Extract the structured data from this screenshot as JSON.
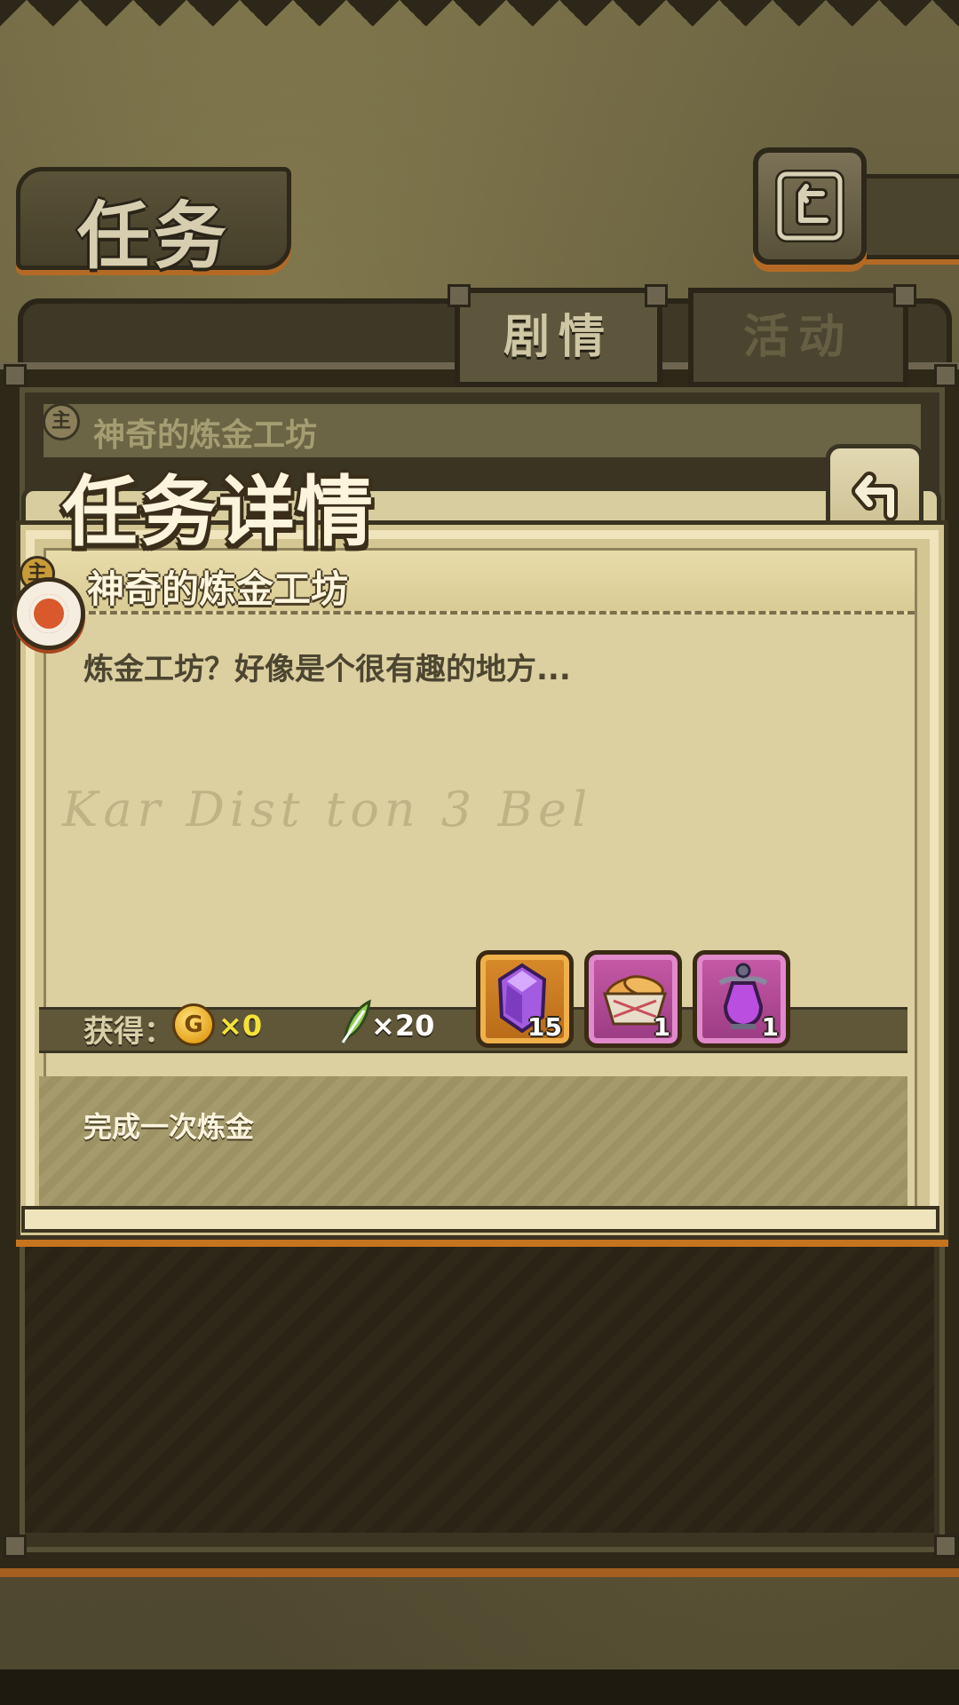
{
  "header": {
    "title": "任务",
    "back_icon": "return-arrow-icon"
  },
  "tabs": [
    {
      "label": "剧情",
      "active": true
    },
    {
      "label": "活动",
      "active": false
    }
  ],
  "quest_list": {
    "items": [
      {
        "badge": "主",
        "name": "神奇的炼金工坊"
      }
    ]
  },
  "detail": {
    "title": "任务详情",
    "badge": "主",
    "quest_name": "神奇的炼金工坊",
    "description": "炼金工坊？好像是个很有趣的地方...",
    "watermark": "Kar Dist ton 3 Bel",
    "rewards": {
      "label": "获得：",
      "coin_symbol": "G",
      "coin_count": "×0",
      "feather_count": "×20",
      "items": [
        {
          "icon": "purple-crystal-icon",
          "qty": "15"
        },
        {
          "icon": "bread-basket-icon",
          "qty": "1"
        },
        {
          "icon": "purple-potion-icon",
          "qty": "1"
        }
      ]
    },
    "task": "完成一次炼金"
  },
  "colors": {
    "accent_orange": "#c7741f",
    "parchment": "#dccfa0",
    "dark_frame": "#2e2819",
    "coin_text": "#f4e23a"
  }
}
